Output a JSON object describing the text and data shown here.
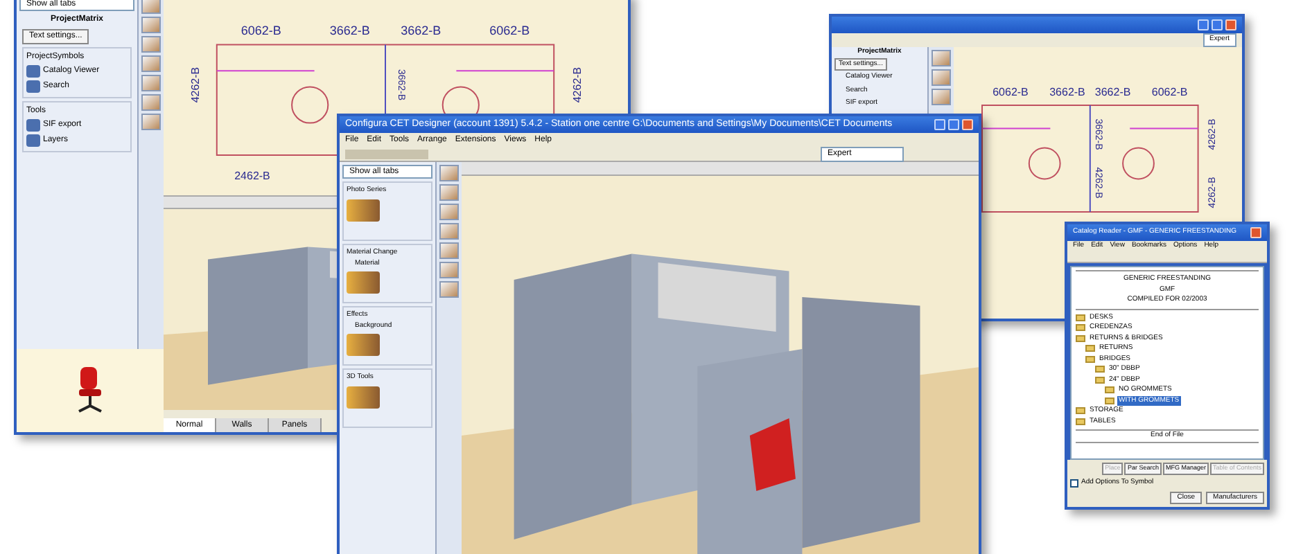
{
  "left_window": {
    "filter": "Show all tabs",
    "panel_title": "ProjectMatrix",
    "settings_button": "Text settings...",
    "groups": [
      {
        "title": "ProjectSymbols",
        "items": [
          "Catalog Viewer",
          "Search"
        ]
      },
      {
        "title": "Tools",
        "items": [
          "SIF export",
          "Layers"
        ]
      }
    ],
    "plan": {
      "top": [
        "6062-B",
        "3662-B",
        "3662-B",
        "6062-B"
      ],
      "side": [
        "4262-B",
        "4262-B"
      ],
      "bottom": "2462-B",
      "middle": "3662-B"
    },
    "view_tabs": [
      {
        "label": "Normal",
        "selected": true
      },
      {
        "label": "Walls",
        "selected": false
      },
      {
        "label": "Panels",
        "selected": false
      }
    ]
  },
  "right_window": {
    "panel_title": "ProjectMatrix",
    "settings_button": "Text settings...",
    "items": [
      "Catalog Viewer",
      "Search",
      "SIF export"
    ],
    "mode": "Expert",
    "plan": {
      "top": [
        "6062-B",
        "3662-B",
        "3662-B",
        "6062-B"
      ],
      "side": [
        "4262-B",
        "4262-B"
      ],
      "middle": [
        "3662-B",
        "4262-B"
      ]
    }
  },
  "main_window": {
    "title": "Configura CET Designer (account 1391) 5.4.2 - Station one centre G:\\Documents and Settings\\My Documents\\CET Documents",
    "menu": [
      "File",
      "Edit",
      "Tools",
      "Arrange",
      "Extensions",
      "Views",
      "Help"
    ],
    "filter": "Show all tabs",
    "mode": "Expert",
    "groups": [
      {
        "title": "Photo Series"
      },
      {
        "title": "Material Change",
        "label": "Material"
      },
      {
        "title": "Effects",
        "label": "Background"
      },
      {
        "title": "3D Tools"
      }
    ]
  },
  "catalog_window": {
    "title": "Catalog Reader - GMF - GENERIC FREESTANDING",
    "menu": [
      "File",
      "Edit",
      "View",
      "Bookmarks",
      "Options",
      "Help"
    ],
    "header": [
      "GENERIC FREESTANDING",
      "GMF",
      "COMPILED FOR 02/2003"
    ],
    "tree": [
      {
        "label": "DESKS",
        "selected": false
      },
      {
        "label": "CREDENZAS",
        "selected": false
      },
      {
        "label": "RETURNS & BRIDGES",
        "selected": false,
        "children": [
          {
            "label": "RETURNS",
            "selected": false
          },
          {
            "label": "BRIDGES",
            "selected": false,
            "children": [
              {
                "label": "30\" DBBP",
                "selected": false
              },
              {
                "label": "24\" DBBP",
                "selected": false,
                "children": [
                  {
                    "label": "NO GROMMETS",
                    "selected": false
                  },
                  {
                    "label": "WITH GROMMETS",
                    "selected": true
                  }
                ]
              }
            ]
          }
        ]
      },
      {
        "label": "STORAGE",
        "selected": false
      },
      {
        "label": "TABLES",
        "selected": false
      }
    ],
    "footer": "End of File",
    "buttons": [
      {
        "label": "Place",
        "disabled": true
      },
      {
        "label": "Par Search",
        "disabled": false
      },
      {
        "label": "MFG Manager",
        "disabled": false
      },
      {
        "label": "Table of Contents",
        "disabled": true
      }
    ],
    "checkbox": {
      "label": "Add Options To Symbol",
      "checked": false
    },
    "bottom_buttons": [
      "Close",
      "Manufacturers"
    ]
  }
}
